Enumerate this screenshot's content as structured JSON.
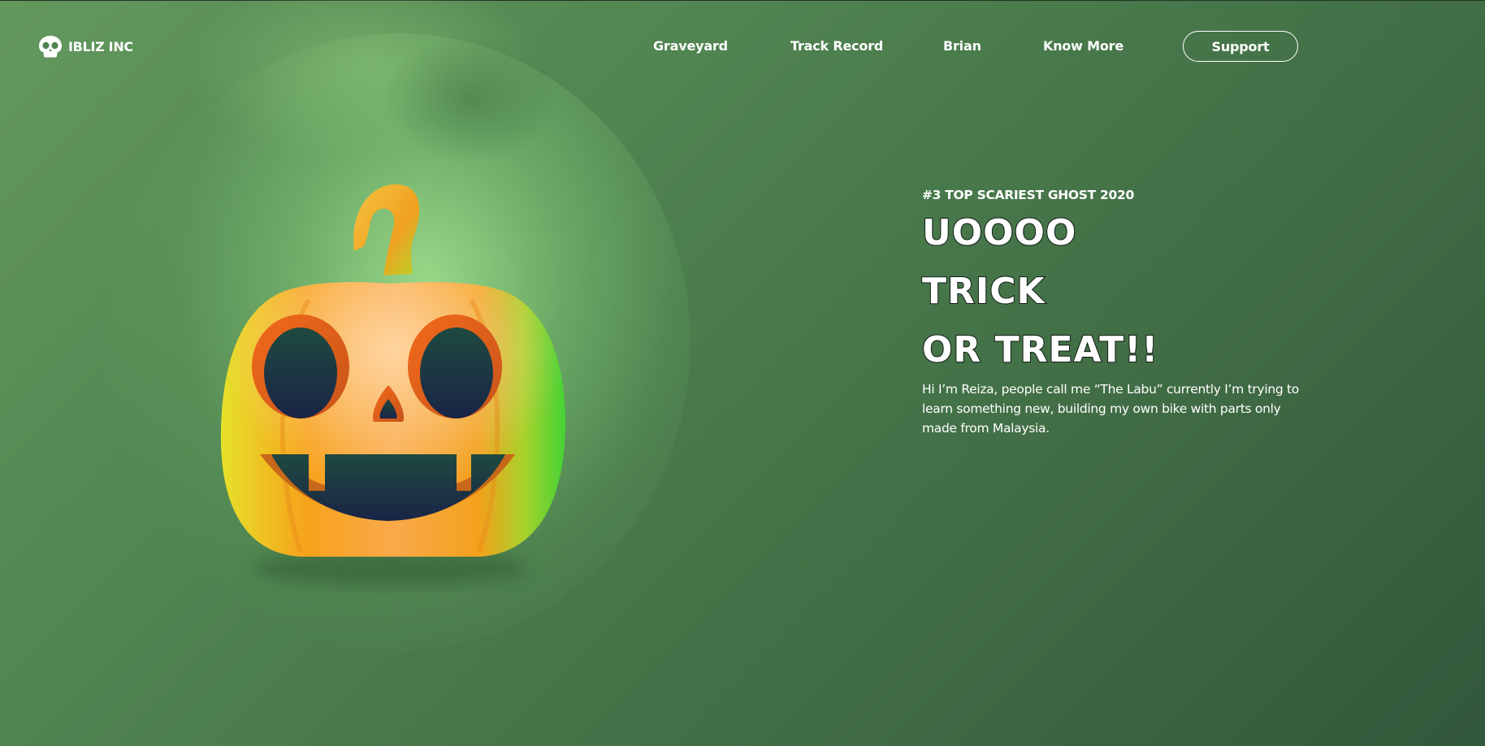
{
  "brand": {
    "name": "IBLIZ INC",
    "logo_icon": "skull-icon"
  },
  "nav": {
    "items": [
      {
        "label": "Graveyard"
      },
      {
        "label": "Track Record"
      },
      {
        "label": "Brian"
      },
      {
        "label": "Know More"
      }
    ],
    "cta_label": "Support"
  },
  "hero": {
    "eyebrow": "#3 TOP SCARIEST GHOST 2020",
    "headline_lines": [
      "UOOOO",
      "TRICK",
      "OR TREAT!!"
    ],
    "description": "Hi I’m Reiza, people call me “The Labu” currently I’m trying to learn something new, building my own bike with parts only made from Malaysia.",
    "illustration": "jack-o-lantern-icon"
  },
  "colors": {
    "background_start": "#63985d",
    "background_end": "#32573b",
    "text": "#ffffff",
    "pumpkin_orange": "#f7a21b",
    "pumpkin_green": "#4fd23a",
    "cavity": "#1d2a45"
  }
}
